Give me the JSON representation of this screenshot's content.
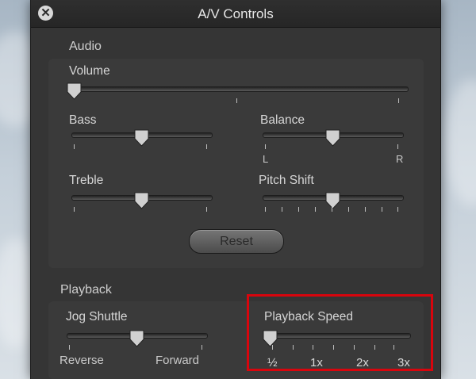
{
  "window": {
    "title": "A/V Controls"
  },
  "audio": {
    "section_label": "Audio",
    "volume": {
      "label": "Volume",
      "value": 0
    },
    "bass": {
      "label": "Bass",
      "value": 0.5
    },
    "balance": {
      "label": "Balance",
      "value": 0.5,
      "left_label": "L",
      "right_label": "R"
    },
    "treble": {
      "label": "Treble",
      "value": 0.5
    },
    "pitch_shift": {
      "label": "Pitch Shift",
      "value": 0.5
    },
    "reset_label": "Reset"
  },
  "playback": {
    "section_label": "Playback",
    "jog_shuttle": {
      "label": "Jog Shuttle",
      "value": 0.5,
      "left_label": "Reverse",
      "right_label": "Forward"
    },
    "playback_speed": {
      "label": "Playback Speed",
      "value": 0,
      "tick_labels": [
        "½",
        "1x",
        "2x",
        "3x"
      ]
    }
  },
  "colors": {
    "highlight": "#d8050d",
    "panel": "#353535",
    "titlebar": "#282828"
  },
  "icons": {
    "close": "close-icon"
  }
}
